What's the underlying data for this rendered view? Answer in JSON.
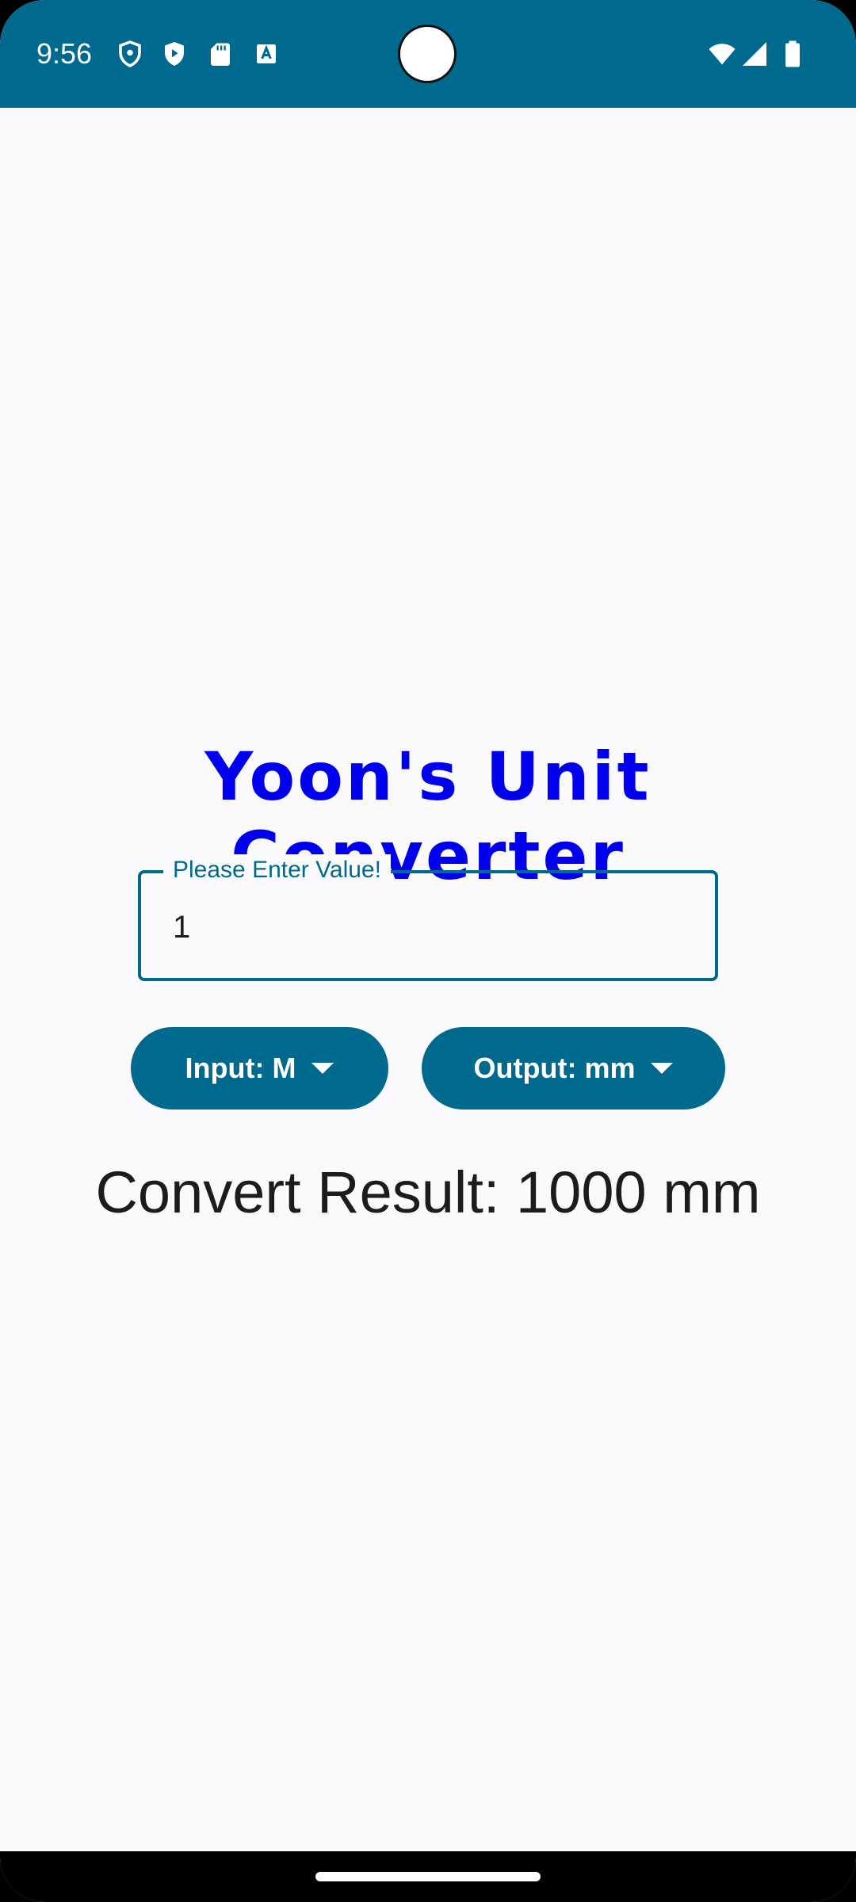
{
  "status_bar": {
    "time": "9:56",
    "background_color": "#006a8e",
    "left_icons": [
      "shield-icon",
      "play-protect-icon",
      "sd-card-icon",
      "keyboard-a-icon"
    ],
    "right_icons": [
      "wifi-icon",
      "cell-signal-icon",
      "battery-icon"
    ]
  },
  "app": {
    "title": "Yoon's Unit Converter",
    "title_color": "#0000ee",
    "accent_color": "#006a8e"
  },
  "value_field": {
    "label": "Please Enter Value!",
    "value": "1"
  },
  "input_unit": {
    "label": "Input: M"
  },
  "output_unit": {
    "label": "Output: mm"
  },
  "result": {
    "text": "Convert Result: 1000 mm"
  }
}
